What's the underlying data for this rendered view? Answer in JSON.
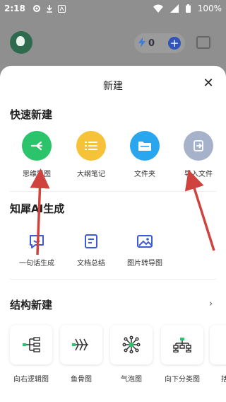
{
  "status_bar": {
    "time": "2:18",
    "battery": "100%"
  },
  "app_bar": {
    "points": "0"
  },
  "sheet": {
    "title": "新建",
    "quick": {
      "title": "快速新建",
      "items": [
        {
          "label": "思维导图",
          "color": "#2bc46b"
        },
        {
          "label": "大纲笔记",
          "color": "#f6c237"
        },
        {
          "label": "文件夹",
          "color": "#2aa6ee"
        },
        {
          "label": "导入文件",
          "color": "#a5b2ca"
        }
      ]
    },
    "ai": {
      "title": "知犀AI生成",
      "items": [
        {
          "label": "一句话生成"
        },
        {
          "label": "文档总结"
        },
        {
          "label": "图片转导图"
        }
      ]
    },
    "structure": {
      "title": "结构新建",
      "items": [
        {
          "label": "向右逻辑图"
        },
        {
          "label": "鱼骨图"
        },
        {
          "label": "气泡图"
        },
        {
          "label": "向下分类图"
        },
        {
          "label": "括"
        }
      ]
    }
  },
  "colors": {
    "accent": "#3d5bd9",
    "annotation_arrow": "#d0423d"
  }
}
